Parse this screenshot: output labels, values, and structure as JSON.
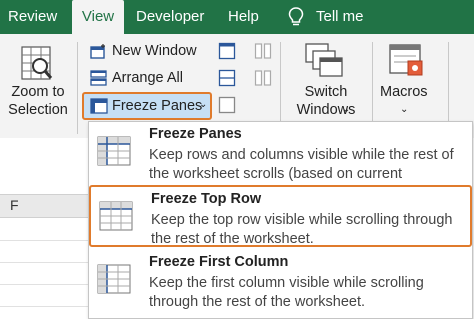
{
  "tabs": [
    {
      "label": "Review",
      "active": false
    },
    {
      "label": "View",
      "active": true
    },
    {
      "label": "Developer",
      "active": false
    },
    {
      "label": "Help",
      "active": false
    }
  ],
  "tell_me": "Tell me",
  "ribbon": {
    "zoom_to_selection": "Zoom to Selection",
    "new_window": "New Window",
    "arrange_all": "Arrange All",
    "freeze_panes": "Freeze Panes",
    "switch_windows": "Switch Windows",
    "macros": "Macros"
  },
  "sheet": {
    "column_header": "F"
  },
  "menu": [
    {
      "title": "Freeze Panes",
      "description": "Keep rows and columns visible while the rest of the worksheet scrolls (based on current selection).",
      "highlighted": false
    },
    {
      "title": "Freeze Top Row",
      "description": "Keep the top row visible while scrolling through the rest of the worksheet.",
      "highlighted": true
    },
    {
      "title": "Freeze First Column",
      "description": "Keep the first column visible while scrolling through the rest of the worksheet.",
      "highlighted": false
    }
  ],
  "colors": {
    "accent_green": "#217346",
    "highlight_orange": "#e07b2c",
    "selected_blue": "#c6dff5"
  },
  "icons": [
    "zoom-to-selection-icon",
    "new-window-icon",
    "arrange-all-icon",
    "freeze-panes-icon",
    "switch-windows-icon",
    "macros-icon",
    "lightbulb-icon"
  ]
}
